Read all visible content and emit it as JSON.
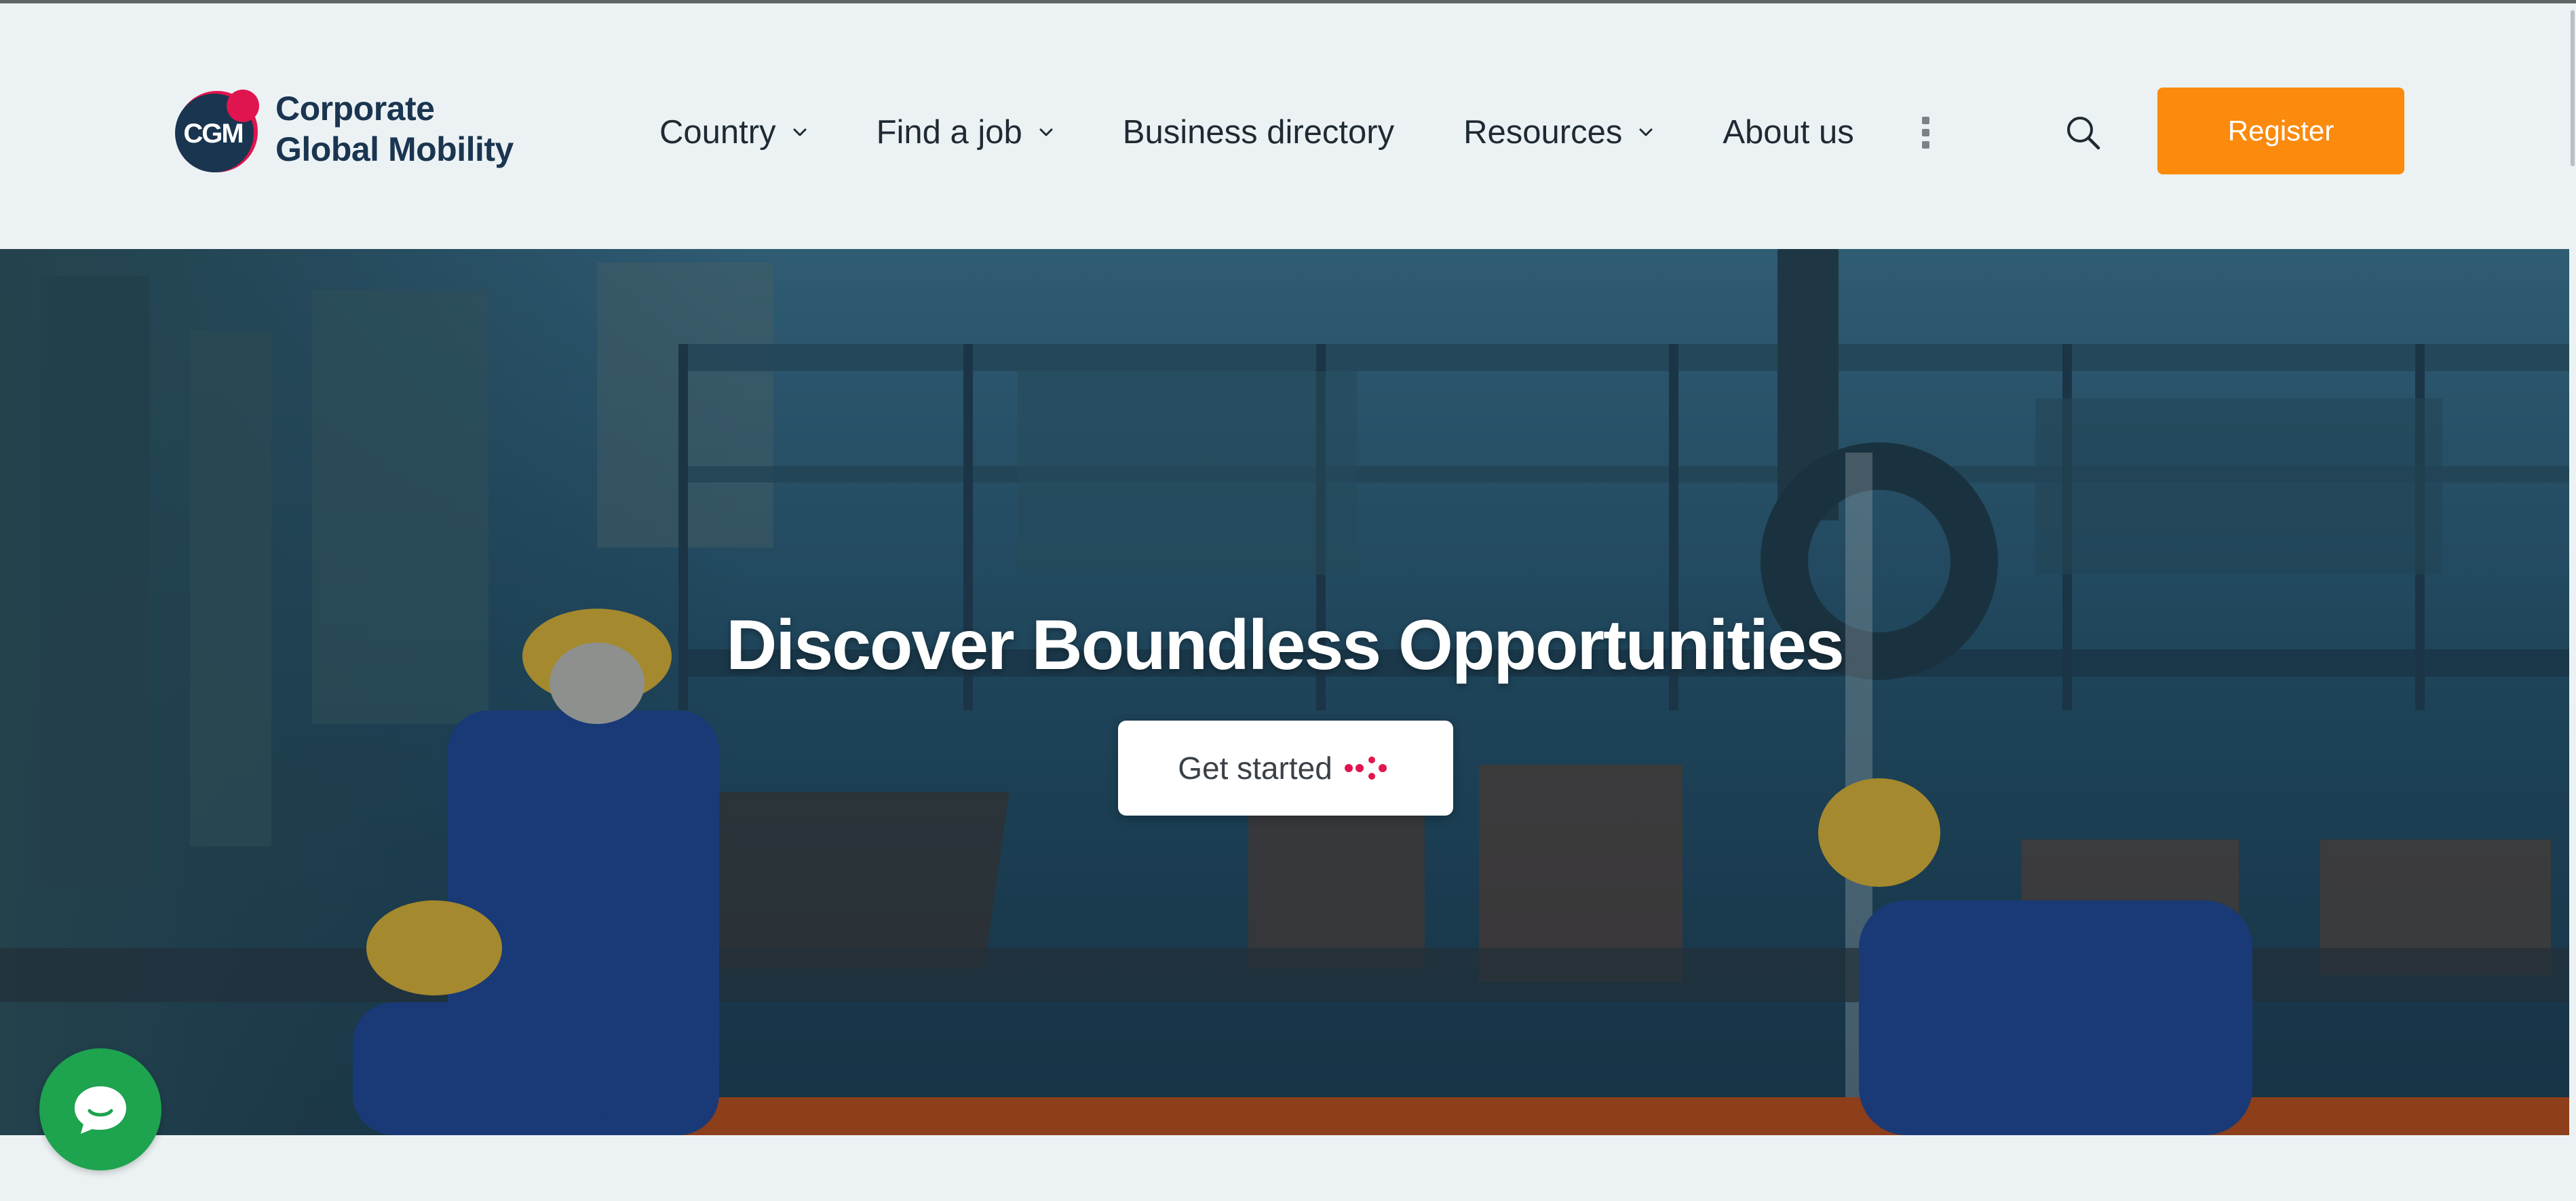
{
  "brand": {
    "logo_mark_text": "CGM",
    "name_line1": "Corporate",
    "name_line2": "Global Mobility"
  },
  "nav": {
    "items": [
      {
        "label": "Country",
        "has_dropdown": true
      },
      {
        "label": "Find a job",
        "has_dropdown": true
      },
      {
        "label": "Business directory",
        "has_dropdown": false
      },
      {
        "label": "Resources",
        "has_dropdown": true
      },
      {
        "label": "About us",
        "has_dropdown": false
      }
    ],
    "more_icon": "kebab-vertical-icon",
    "search_icon": "search-icon",
    "register_label": "Register"
  },
  "hero": {
    "title": "Discover Boundless Opportunities",
    "cta_label": "Get started",
    "cta_icon": "dots-icon"
  },
  "chat": {
    "icon": "chat-bubble-icon"
  },
  "colors": {
    "accent_orange": "#fb8a0d",
    "brand_navy": "#1a3550",
    "brand_red": "#e0154f",
    "chat_green": "#1ea34f",
    "page_bg": "#ecf2f4"
  }
}
